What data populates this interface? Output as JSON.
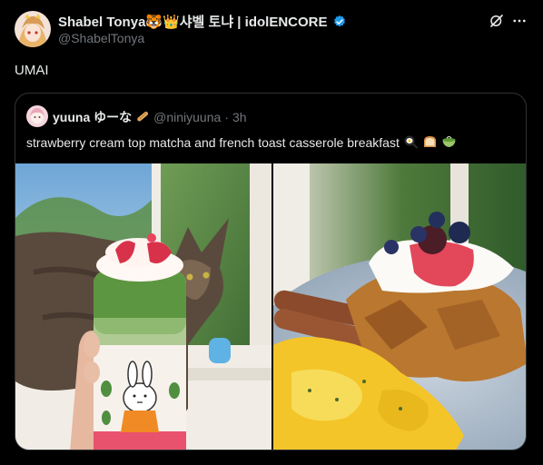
{
  "author": {
    "display_name": "Shabel Tonya🐯👑샤벨 토냐 | idolENCORE",
    "handle": "@ShabelTonya"
  },
  "tweet": {
    "text": "UMAI"
  },
  "quote": {
    "display_name": "yuuna ゆーな",
    "handle": "@niniyuuna",
    "separator": "·",
    "time": "3h",
    "text": "strawberry cream top matcha and french toast casserole breakfast"
  },
  "icons": {
    "verified": "verified-badge-icon",
    "grok": "grok-icon",
    "more": "more-icon",
    "baguette": "baguette-emoji",
    "fried_egg": "fried-egg-emoji",
    "bread": "bread-emoji",
    "matcha": "matcha-emoji"
  },
  "colors": {
    "background": "#000000",
    "text": "#e7e9ea",
    "secondary_text": "#71767b",
    "verified": "#1d9bf0",
    "border": "#2f3336"
  }
}
